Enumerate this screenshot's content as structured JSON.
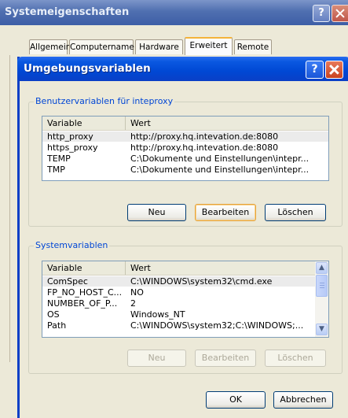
{
  "back_window": {
    "title": "Systemeigenschaften",
    "help_label": "?",
    "tabs": [
      {
        "label": "Allgemein"
      },
      {
        "label": "Computername"
      },
      {
        "label": "Hardware"
      },
      {
        "label": "Erweitert"
      },
      {
        "label": "Remote"
      }
    ],
    "active_tab": "Erweitert"
  },
  "dialog": {
    "title": "Umgebungsvariablen",
    "help_label": "?",
    "user_group": {
      "label": "Benutzervariablen für inteproxy",
      "columns": [
        "Variable",
        "Wert"
      ],
      "rows": [
        {
          "variable": "http_proxy",
          "value": "http://proxy.hq.intevation.de:8080"
        },
        {
          "variable": "https_proxy",
          "value": "http://proxy.hq.intevation.de:8080"
        },
        {
          "variable": "TEMP",
          "value": "C:\\Dokumente und Einstellungen\\intepr..."
        },
        {
          "variable": "TMP",
          "value": "C:\\Dokumente und Einstellungen\\intepr..."
        }
      ],
      "buttons": {
        "new": "Neu",
        "edit": "Bearbeiten",
        "delete": "Löschen"
      }
    },
    "system_group": {
      "label": "Systemvariablen",
      "columns": [
        "Variable",
        "Wert"
      ],
      "rows": [
        {
          "variable": "ComSpec",
          "value": "C:\\WINDOWS\\system32\\cmd.exe"
        },
        {
          "variable": "FP_NO_HOST_C...",
          "value": "NO"
        },
        {
          "variable": "NUMBER_OF_P...",
          "value": "2"
        },
        {
          "variable": "OS",
          "value": "Windows_NT"
        },
        {
          "variable": "Path",
          "value": "C:\\WINDOWS\\system32;C:\\WINDOWS;..."
        }
      ],
      "buttons": {
        "new": "Neu",
        "edit": "Bearbeiten",
        "delete": "Löschen"
      }
    },
    "ok_label": "OK",
    "cancel_label": "Abbrechen"
  },
  "colors": {
    "title_bar": "#0048d4",
    "group_label": "#0046d5",
    "dialog_background": "#ECE9D8"
  }
}
